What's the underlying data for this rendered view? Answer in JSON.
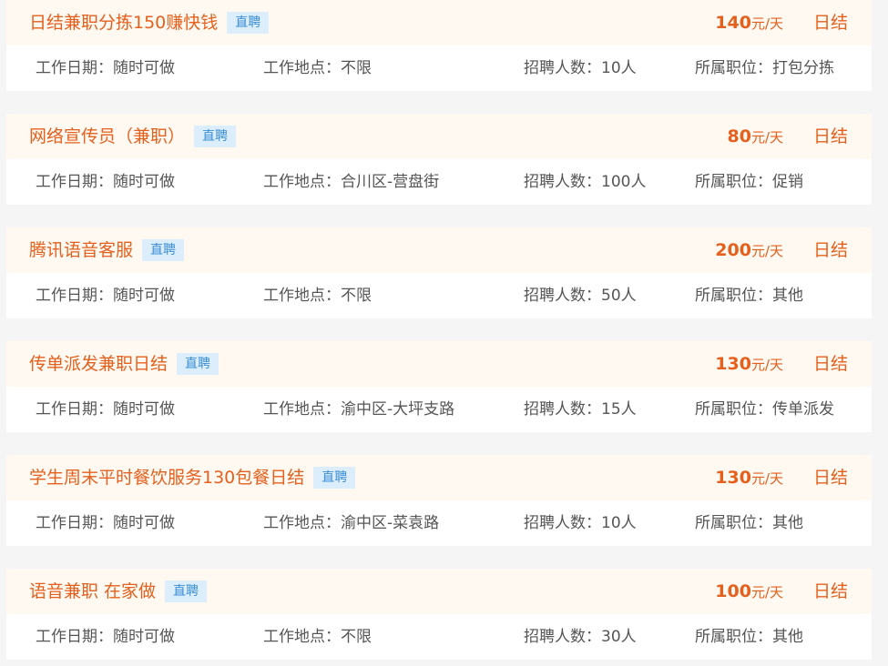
{
  "labels": {
    "work_date": "工作日期：",
    "location": "工作地点：",
    "headcount": "招聘人数：",
    "position": "所属职位："
  },
  "jobs": [
    {
      "title": "日结兼职分拣150赚快钱",
      "tag": "直聘",
      "salary": "140",
      "unit": "元/天",
      "settle": "日结",
      "date": "随时可做",
      "location": "不限",
      "headcount": "10人",
      "position": "打包分拣"
    },
    {
      "title": "网络宣传员（兼职）",
      "tag": "直聘",
      "salary": "80",
      "unit": "元/天",
      "settle": "日结",
      "date": "随时可做",
      "location": "合川区-营盘街",
      "headcount": "100人",
      "position": "促销"
    },
    {
      "title": "腾讯语音客服",
      "tag": "直聘",
      "salary": "200",
      "unit": "元/天",
      "settle": "日结",
      "date": "随时可做",
      "location": "不限",
      "headcount": "50人",
      "position": "其他"
    },
    {
      "title": "传单派发兼职日结",
      "tag": "直聘",
      "salary": "130",
      "unit": "元/天",
      "settle": "日结",
      "date": "随时可做",
      "location": "渝中区-大坪支路",
      "headcount": "15人",
      "position": "传单派发"
    },
    {
      "title": "学生周末平时餐饮服务130包餐日结",
      "tag": "直聘",
      "salary": "130",
      "unit": "元/天",
      "settle": "日结",
      "date": "随时可做",
      "location": "渝中区-菜袁路",
      "headcount": "10人",
      "position": "其他"
    },
    {
      "title": "语音兼职 在家做",
      "tag": "直聘",
      "salary": "100",
      "unit": "元/天",
      "settle": "日结",
      "date": "随时可做",
      "location": "不限",
      "headcount": "30人",
      "position": "其他"
    }
  ]
}
